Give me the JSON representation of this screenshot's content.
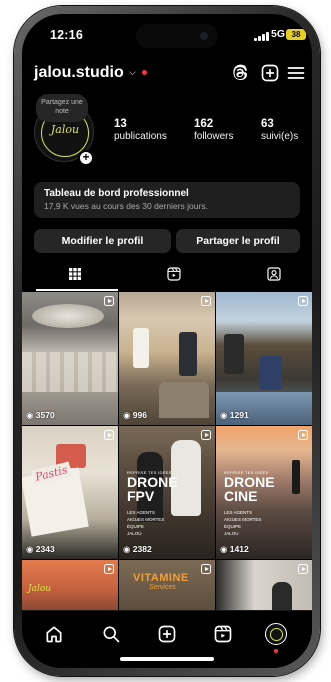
{
  "status_bar": {
    "time": "12:16",
    "network": "5G",
    "battery": "38"
  },
  "header": {
    "username": "jalou.studio",
    "icons": [
      "threads-icon",
      "create-post-icon",
      "menu-icon"
    ]
  },
  "profile": {
    "note": "Partagez une note",
    "avatar_text": "Jalou",
    "stats": [
      {
        "value": "13",
        "label": "publications"
      },
      {
        "value": "162",
        "label": "followers"
      },
      {
        "value": "63",
        "label": "suivi(e)s"
      }
    ]
  },
  "dashboard": {
    "title": "Tableau de bord professionnel",
    "subtitle": "17,9 K vues au cours des 30 derniers jours."
  },
  "buttons": {
    "edit": "Modifier le profil",
    "share": "Partager le profil"
  },
  "tabs": [
    "grid-tab-icon",
    "reels-tab-icon",
    "tagged-tab-icon"
  ],
  "grid": [
    {
      "views": "3570"
    },
    {
      "views": "996"
    },
    {
      "views": "1291"
    },
    {
      "views": "2343",
      "text": "Pastis"
    },
    {
      "views": "2382",
      "kicker": "REPRISE TES IDÉES",
      "title_line1": "DRONE",
      "title_line2": "FPV",
      "details": [
        "LES AGENTS",
        "AIGUES MORTES",
        "ÉQUIPE",
        "JALOU"
      ]
    },
    {
      "views": "1412",
      "kicker": "REPRISE TES IDÉES",
      "title_line1": "DRONE",
      "title_line2": "CINE",
      "details": [
        "LES AGENTS",
        "AIGUES MORTES",
        "ÉQUIPE",
        "JALOU"
      ]
    },
    {
      "views": "",
      "text": "Jalou"
    },
    {
      "views": "",
      "text": "VITAMINE",
      "text2": "Services"
    },
    {
      "views": ""
    }
  ],
  "bottom_nav": [
    "home-icon",
    "search-icon",
    "create-icon",
    "reels-icon",
    "profile-avatar"
  ]
}
